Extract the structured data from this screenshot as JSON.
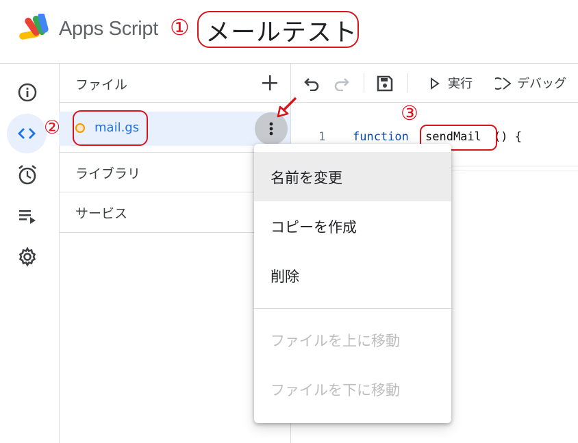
{
  "header": {
    "app_name": "Apps Script",
    "project_title": "メールテスト",
    "annotation": "①"
  },
  "rail": {
    "items": [
      {
        "name": "overview",
        "icon": "info-icon"
      },
      {
        "name": "editor",
        "icon": "code-icon",
        "active": true
      },
      {
        "name": "triggers",
        "icon": "alarm-icon"
      },
      {
        "name": "executions",
        "icon": "list-play-icon"
      },
      {
        "name": "settings",
        "icon": "gear-icon"
      }
    ]
  },
  "files_panel": {
    "title": "ファイル",
    "file": {
      "name": "mail.gs",
      "annotation": "②"
    },
    "sections": [
      {
        "label": "ライブラリ"
      },
      {
        "label": "サービス"
      }
    ]
  },
  "toolbar": {
    "run_label": "実行",
    "debug_label": "デバッグ"
  },
  "editor": {
    "line_number": "1",
    "keyword": "function",
    "function_name": "sendMail",
    "rest": "() {",
    "annotation": "③"
  },
  "context_menu": {
    "items": [
      {
        "label": "名前を変更",
        "disabled": false,
        "hover": true
      },
      {
        "label": "コピーを作成",
        "disabled": false
      },
      {
        "label": "削除",
        "disabled": false
      },
      {
        "label": "ファイルを上に移動",
        "disabled": true
      },
      {
        "label": "ファイルを下に移動",
        "disabled": true
      }
    ]
  },
  "colors": {
    "annotation_red": "#d6141a",
    "active_blue": "#1a73e8",
    "active_bg": "#e8f0fe"
  }
}
